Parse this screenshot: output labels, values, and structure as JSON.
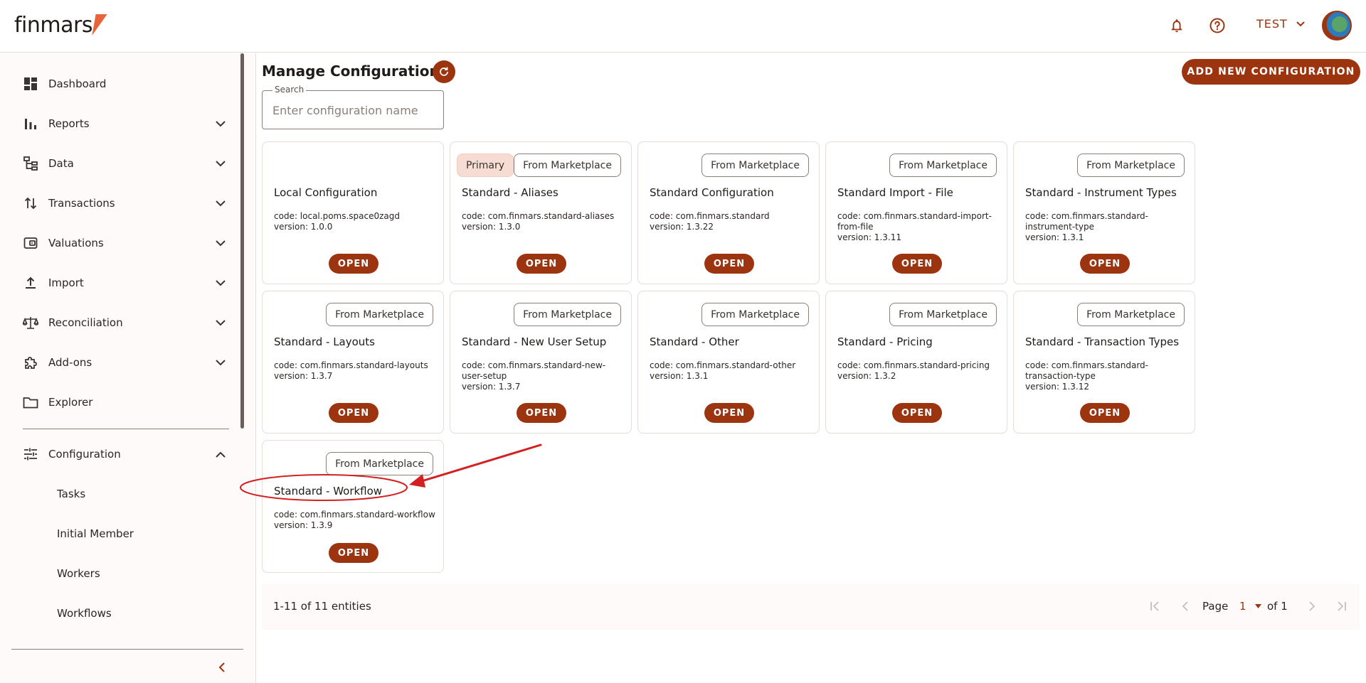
{
  "app": {
    "logo_text": "finmars"
  },
  "header": {
    "user_label": "TEST"
  },
  "sidebar": {
    "items": [
      {
        "label": "Dashboard",
        "icon": "dashboard-icon"
      },
      {
        "label": "Reports",
        "icon": "bar-chart-icon"
      },
      {
        "label": "Data",
        "icon": "tree-icon"
      },
      {
        "label": "Transactions",
        "icon": "swap-vertical-icon"
      },
      {
        "label": "Valuations",
        "icon": "wallet-icon"
      },
      {
        "label": "Import",
        "icon": "upload-icon"
      },
      {
        "label": "Reconciliation",
        "icon": "scale-icon"
      },
      {
        "label": "Add-ons",
        "icon": "puzzle-icon"
      },
      {
        "label": "Explorer",
        "icon": "folder-icon"
      },
      {
        "label": "Configuration",
        "icon": "tune-icon"
      }
    ],
    "sub_items": [
      {
        "label": "Tasks"
      },
      {
        "label": "Initial Member"
      },
      {
        "label": "Workers"
      },
      {
        "label": "Workflows"
      }
    ]
  },
  "main": {
    "title": "Manage Configuration",
    "add_button": "ADD NEW CONFIGURATION",
    "search": {
      "legend": "Search",
      "placeholder": "Enter configuration name"
    },
    "open_label": "OPEN",
    "badge_primary": "Primary",
    "badge_marketplace": "From Marketplace",
    "cards": [
      {
        "name": "Local Configuration",
        "code": "code: local.poms.space0zagd",
        "version": "version: 1.0.0"
      },
      {
        "name": "Standard - Aliases",
        "code": "code: com.finmars.standard-aliases",
        "version": "version: 1.3.0"
      },
      {
        "name": "Standard Configuration",
        "code": "code: com.finmars.standard",
        "version": "version: 1.3.22"
      },
      {
        "name": "Standard Import - File",
        "code": "code: com.finmars.standard-import-from-file",
        "version": "version: 1.3.11"
      },
      {
        "name": "Standard - Instrument Types",
        "code": "code: com.finmars.standard-instrument-type",
        "version": "version: 1.3.1"
      },
      {
        "name": "Standard - Layouts",
        "code": "code: com.finmars.standard-layouts",
        "version": "version: 1.3.7"
      },
      {
        "name": "Standard - New User Setup",
        "code": "code: com.finmars.standard-new-user-setup",
        "version": "version: 1.3.7"
      },
      {
        "name": "Standard - Other",
        "code": "code: com.finmars.standard-other",
        "version": "version: 1.3.1"
      },
      {
        "name": "Standard - Pricing",
        "code": "code: com.finmars.standard-pricing",
        "version": "version: 1.3.2"
      },
      {
        "name": "Standard - Transaction Types",
        "code": "code: com.finmars.standard-transaction-type",
        "version": "version: 1.3.12"
      },
      {
        "name": "Standard - Workflow",
        "code": "code: com.finmars.standard-workflow",
        "version": "version: 1.3.9"
      }
    ]
  },
  "pagination": {
    "count": "1-11 of 11 entities",
    "page_label": "Page",
    "page_value": "1",
    "of_label": "of 1"
  },
  "colors": {
    "accent": "#9c3410",
    "annotation": "#d42020",
    "logo_mark": "#e8643a"
  }
}
